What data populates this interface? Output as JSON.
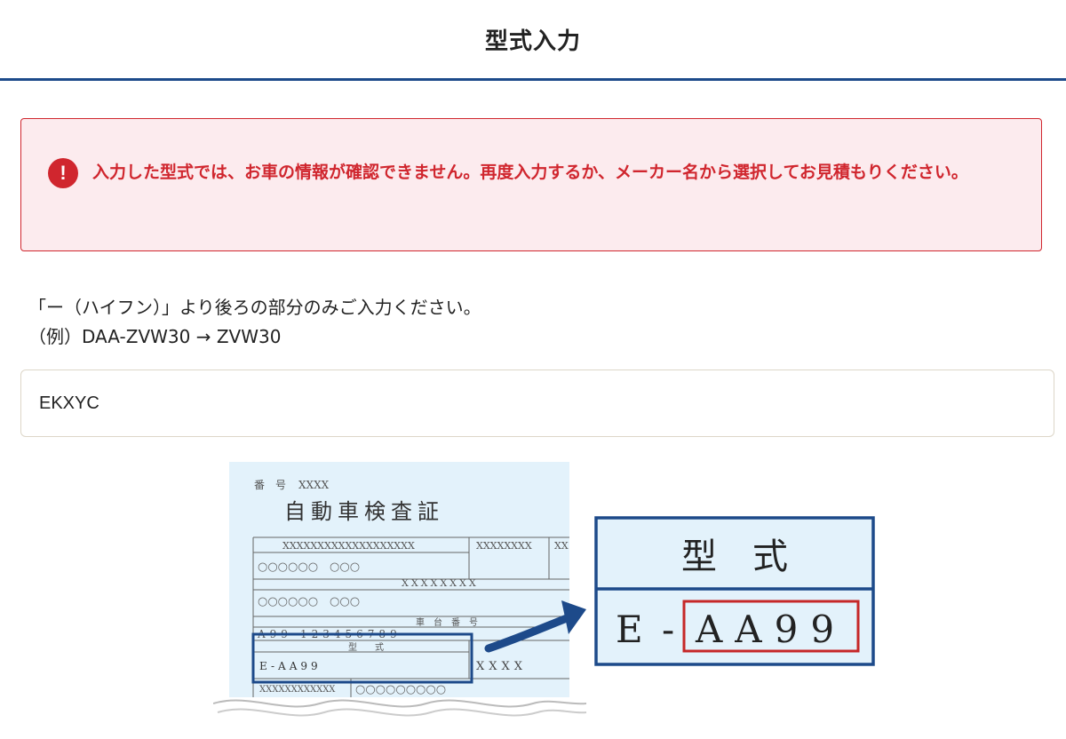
{
  "header": {
    "title": "型式入力"
  },
  "error": {
    "icon": "exclamation-icon",
    "message": "入力した型式では、お車の情報が確認できません。再度入力するか、メーカー名から選択してお見積もりください。"
  },
  "instructions": {
    "line1": "「ー（ハイフン）」より後ろの部分のみご入力ください。",
    "line2": "（例）DAA-ZVW30 → ZVW30"
  },
  "model_input": {
    "value": "EKXYC"
  },
  "certificate": {
    "number_label": "番　号",
    "number_value": "XXXX",
    "title": "自動車検査証",
    "row1_a": "XXXXXXXXXXXXXXXXXXX",
    "row1_b": "XXXXXXXX",
    "row1_c": "XX",
    "row2": "○○○○○○　○○○",
    "row3": "XXXXXXXX",
    "row4": "○○○○○○　○○○",
    "chassis_label": "車　台　番　号",
    "chassis_value": "A99-123456789",
    "model_label": "型　　式",
    "model_value": "E-AA99",
    "right_value": "XXXX",
    "bottom_a": "XXXXXXXXXXXX",
    "bottom_b": "○○○○○○○○○"
  },
  "zoom": {
    "label": "型　式",
    "prefix": "E -",
    "highlight": "AA99"
  },
  "colors": {
    "accent": "#1d4a8a",
    "error": "#d0262e",
    "error_bg": "#fcebee",
    "card_bg": "#e3f2fb"
  }
}
